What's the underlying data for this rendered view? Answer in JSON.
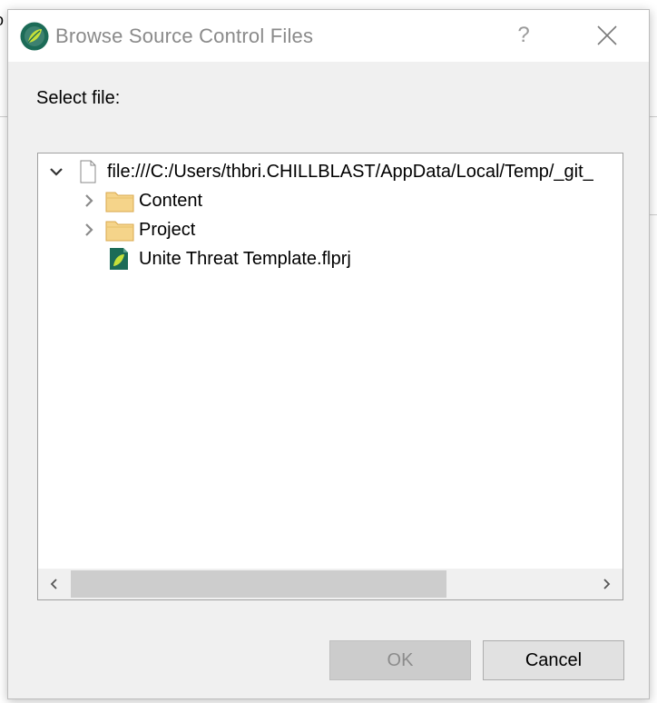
{
  "background": {
    "fragment_text": "o"
  },
  "dialog": {
    "title": "Browse Source Control Files",
    "help_label": "?",
    "select_label": "Select file:",
    "tree": [
      {
        "label": "file:///C:/Users/thbri.CHILLBLAST/AppData/Local/Temp/_git_",
        "icon": "file-icon",
        "expanded": true
      },
      {
        "label": "Content",
        "icon": "folder-icon",
        "expanded": false
      },
      {
        "label": "Project",
        "icon": "folder-icon",
        "expanded": false
      },
      {
        "label": "Unite Threat Template.flprj",
        "icon": "project-file-icon"
      }
    ],
    "buttons": {
      "ok": "OK",
      "cancel": "Cancel"
    },
    "colors": {
      "title_text": "#8a8a8a",
      "folder": "#f5d48a",
      "app_icon": "#1c6b57",
      "disabled_button": "#cccccc"
    }
  }
}
